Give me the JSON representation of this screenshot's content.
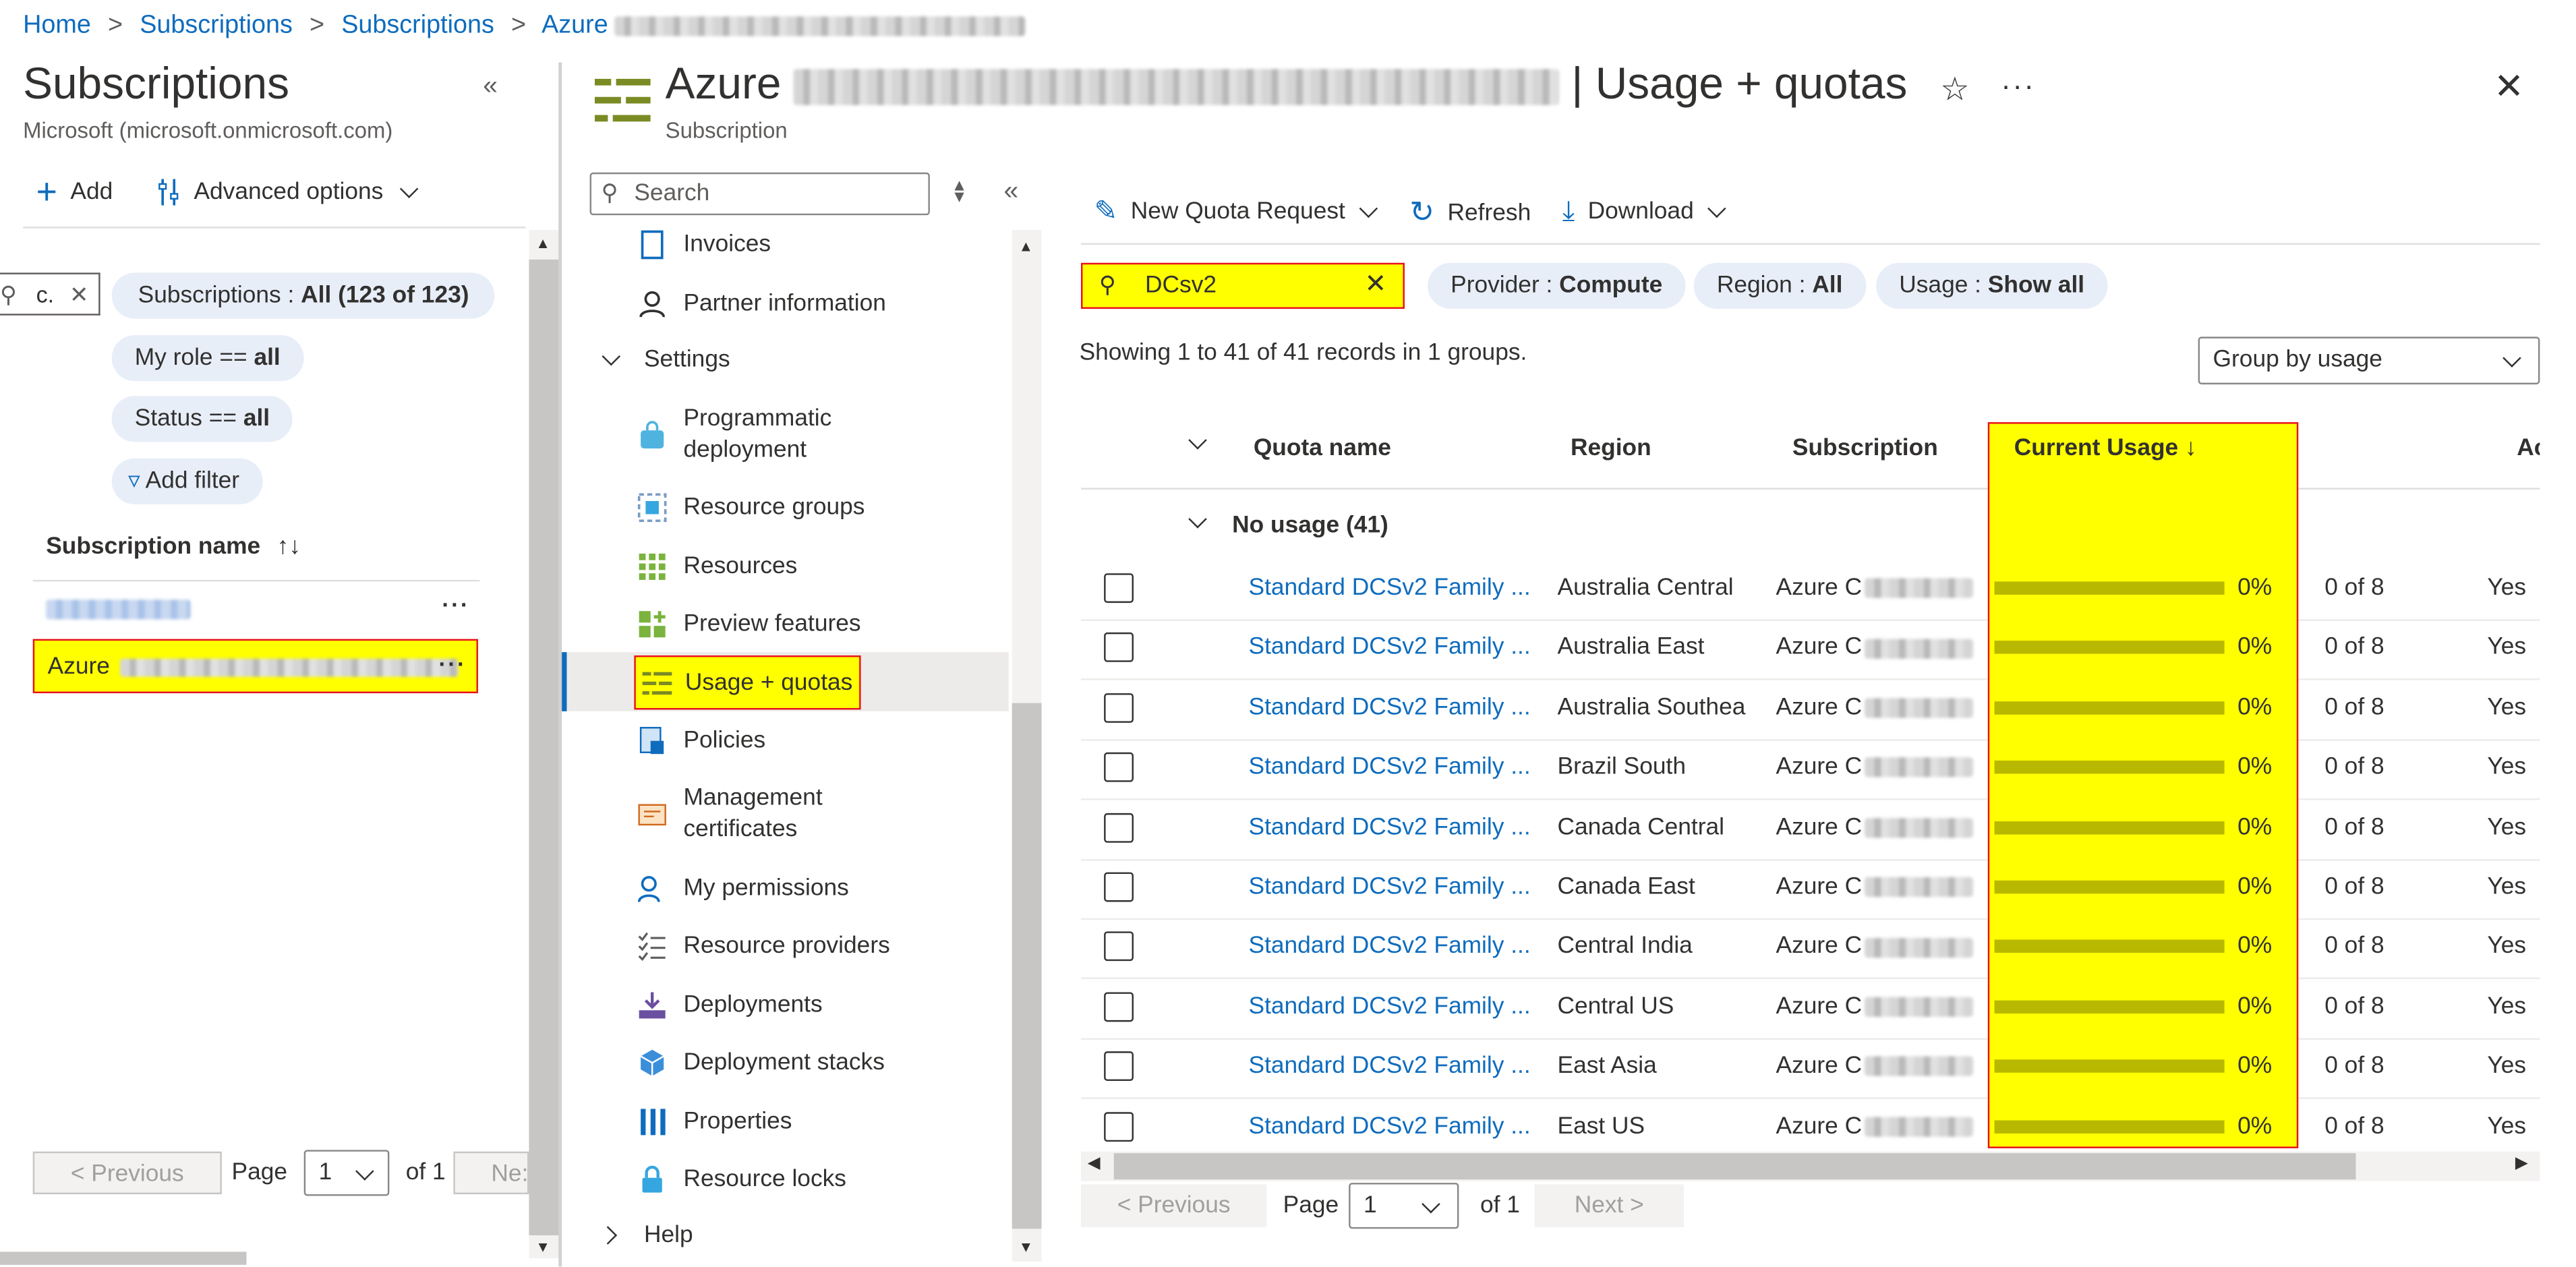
{
  "breadcrumb": {
    "home": "Home",
    "subscriptions1": "Subscriptions",
    "subscriptions2": "Subscriptions",
    "azure": "Azure"
  },
  "left": {
    "title": "Subscriptions",
    "tenant": "Microsoft (microsoft.onmicrosoft.com)",
    "add_label": "Add",
    "advanced_label": "Advanced options",
    "search_value": "c.",
    "filters": {
      "subs_prefix": "Subscriptions : ",
      "subs_value": "All (123 of 123)",
      "role_prefix": "My role == ",
      "role_value": "all",
      "status_prefix": "Status == ",
      "status_value": "all",
      "add_filter": "Add filter"
    },
    "column_header": "Subscription name",
    "selected_item_prefix": "Azure",
    "pager": {
      "previous": "< Previous",
      "page_label": "Page",
      "page_value": "1",
      "of_label": "of 1",
      "next": "Ne:"
    }
  },
  "blade": {
    "title_prefix": "Azure",
    "title_suffix": "| Usage + quotas",
    "subtitle": "Subscription"
  },
  "menu": {
    "search_placeholder": "Search",
    "items": {
      "invoices": "Invoices",
      "partner": "Partner information",
      "settings": "Settings",
      "programmatic": "Programmatic\ndeployment",
      "resource_groups": "Resource groups",
      "resources": "Resources",
      "preview": "Preview features",
      "usage": "Usage + quotas",
      "policies": "Policies",
      "management": "Management\ncertificates",
      "permissions": "My permissions",
      "providers": "Resource providers",
      "deployments": "Deployments",
      "stacks": "Deployment stacks",
      "properties": "Properties",
      "locks": "Resource locks",
      "help": "Help"
    }
  },
  "toolbar": {
    "new_quota": "New Quota Request",
    "refresh": "Refresh",
    "download": "Download"
  },
  "filterbar": {
    "search_value": "DCsv2",
    "provider_prefix": "Provider : ",
    "provider_value": "Compute",
    "region_prefix": "Region : ",
    "region_value": "All",
    "usage_prefix": "Usage : ",
    "usage_value": "Show all"
  },
  "showing": "Showing 1 to 41 of 41 records in 1 groups.",
  "group_by": "Group by usage",
  "table": {
    "headers": {
      "quota": "Quota name",
      "region": "Region",
      "subscription": "Subscription",
      "usage": "Current Usage ↓",
      "adj": "Ac"
    },
    "group_label": "No usage (41)",
    "rows": [
      {
        "quota": "Standard DCSv2 Family ...",
        "region": "Australia Central",
        "sub": "Azure C",
        "usage_pct": "0%",
        "of": "0 of 8",
        "adj": "Yes"
      },
      {
        "quota": "Standard DCSv2 Family ...",
        "region": "Australia East",
        "sub": "Azure C",
        "usage_pct": "0%",
        "of": "0 of 8",
        "adj": "Yes"
      },
      {
        "quota": "Standard DCSv2 Family ...",
        "region": "Australia Southea",
        "sub": "Azure C",
        "usage_pct": "0%",
        "of": "0 of 8",
        "adj": "Yes"
      },
      {
        "quota": "Standard DCSv2 Family ...",
        "region": "Brazil South",
        "sub": "Azure C",
        "usage_pct": "0%",
        "of": "0 of 8",
        "adj": "Yes"
      },
      {
        "quota": "Standard DCSv2 Family ...",
        "region": "Canada Central",
        "sub": "Azure C",
        "usage_pct": "0%",
        "of": "0 of 8",
        "adj": "Yes"
      },
      {
        "quota": "Standard DCSv2 Family ...",
        "region": "Canada East",
        "sub": "Azure C",
        "usage_pct": "0%",
        "of": "0 of 8",
        "adj": "Yes"
      },
      {
        "quota": "Standard DCSv2 Family ...",
        "region": "Central India",
        "sub": "Azure C",
        "usage_pct": "0%",
        "of": "0 of 8",
        "adj": "Yes"
      },
      {
        "quota": "Standard DCSv2 Family ...",
        "region": "Central US",
        "sub": "Azure C",
        "usage_pct": "0%",
        "of": "0 of 8",
        "adj": "Yes"
      },
      {
        "quota": "Standard DCSv2 Family ...",
        "region": "East Asia",
        "sub": "Azure C",
        "usage_pct": "0%",
        "of": "0 of 8",
        "adj": "Yes"
      },
      {
        "quota": "Standard DCSv2 Family ...",
        "region": "East US",
        "sub": "Azure C",
        "usage_pct": "0%",
        "of": "0 of 8",
        "adj": "Yes"
      }
    ]
  },
  "pager": {
    "previous": "< Previous",
    "page_label": "Page",
    "page_value": "1",
    "of_label": "of 1",
    "next": "Next >"
  },
  "colors": {
    "link": "#0f6cbd",
    "highlight": "#ffff00",
    "highlight_border": "#e81123",
    "usage_bar": "#b8b800"
  }
}
